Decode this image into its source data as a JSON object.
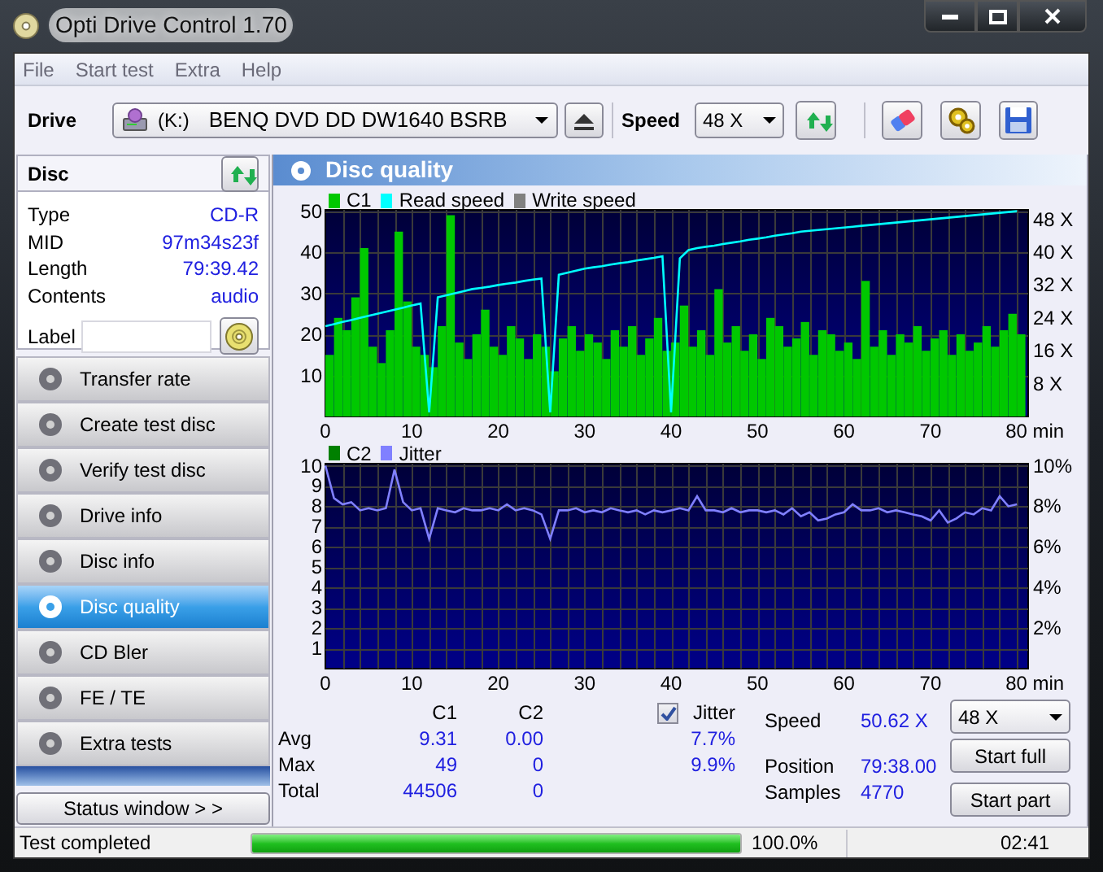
{
  "window": {
    "title": "Opti Drive Control 1.70"
  },
  "menu": [
    "File",
    "Start test",
    "Extra",
    "Help"
  ],
  "toolbar": {
    "drive_label": "Drive",
    "drive_letter": "(K:)",
    "drive_name": "BENQ DVD DD DW1640 BSRB",
    "speed_label": "Speed",
    "speed": "48 X"
  },
  "disc": {
    "title": "Disc",
    "fields": [
      {
        "label": "Type",
        "value": "CD-R"
      },
      {
        "label": "MID",
        "value": "97m34s23f"
      },
      {
        "label": "Length",
        "value": "79:39.42"
      },
      {
        "label": "Contents",
        "value": "audio"
      }
    ],
    "label_field": "Label"
  },
  "nav": [
    {
      "label": "Transfer rate",
      "selected": false
    },
    {
      "label": "Create test disc",
      "selected": false
    },
    {
      "label": "Verify test disc",
      "selected": false
    },
    {
      "label": "Drive info",
      "selected": false
    },
    {
      "label": "Disc info",
      "selected": false
    },
    {
      "label": "Disc quality",
      "selected": true
    },
    {
      "label": "CD Bler",
      "selected": false
    },
    {
      "label": "FE / TE",
      "selected": false
    },
    {
      "label": "Extra tests",
      "selected": false
    }
  ],
  "status_window_button": "Status window > >",
  "panel": {
    "title": "Disc quality",
    "charts": [
      {
        "chart_data": {
          "type": "bar",
          "x": [
            0,
            1,
            2,
            3,
            4,
            5,
            6,
            7,
            8,
            9,
            10,
            11,
            12,
            13,
            14,
            15,
            16,
            17,
            18,
            19,
            20,
            21,
            22,
            23,
            24,
            25,
            26,
            27,
            28,
            29,
            30,
            31,
            32,
            33,
            34,
            35,
            36,
            37,
            38,
            39,
            40,
            41,
            42,
            43,
            44,
            45,
            46,
            47,
            48,
            49,
            50,
            51,
            52,
            53,
            54,
            55,
            56,
            57,
            58,
            59,
            60,
            61,
            62,
            63,
            64,
            65,
            66,
            67,
            68,
            69,
            70,
            71,
            72,
            73,
            74,
            75,
            76,
            77,
            78,
            79,
            80
          ],
          "xlim": [
            0,
            81.3
          ],
          "ylim": [
            0,
            50.3
          ],
          "grid": true,
          "xticks": [
            0,
            10,
            20,
            30,
            40,
            50,
            60,
            70,
            {
              "value": 80,
              "label": "80 min"
            }
          ],
          "yticks": [
            10,
            20,
            30,
            40,
            50
          ],
          "y2lim": [
            0,
            50.3
          ],
          "y2ticks": [
            {
              "value": 8,
              "label": "8 X"
            },
            {
              "value": 16,
              "label": "16 X"
            },
            {
              "value": 24,
              "label": "24 X"
            },
            {
              "value": 32,
              "label": "32 X"
            },
            {
              "value": 40,
              "label": "40 X"
            },
            {
              "value": 48,
              "label": "48 X"
            }
          ],
          "series": [
            {
              "name": "C1",
              "color": "#00c800",
              "values": [
                15,
                24,
                21,
                29,
                41,
                17,
                13,
                21,
                45,
                28,
                17,
                15,
                12,
                22,
                49,
                18,
                14,
                20,
                26,
                17,
                15,
                22,
                19,
                14,
                20,
                17,
                11,
                19,
                22,
                16,
                20,
                18,
                14,
                21,
                17,
                22,
                15,
                19,
                24,
                16,
                18,
                27,
                17,
                21,
                15,
                31,
                18,
                22,
                16,
                20,
                14,
                24,
                22,
                17,
                19,
                23,
                15,
                21,
                20,
                16,
                18,
                14,
                33,
                17,
                21,
                15,
                20,
                18,
                22,
                16,
                19,
                21,
                15,
                20,
                16,
                18,
                22,
                17,
                21,
                25,
                20
              ]
            },
            {
              "name": "Read speed",
              "color": "#00ffff",
              "type": "line",
              "values": [
                22,
                22.5,
                23,
                23.5,
                24,
                24.5,
                25,
                25.5,
                26,
                26.5,
                27,
                27.5,
                1,
                29,
                29.5,
                30,
                30.5,
                31,
                31.3,
                31.6,
                32,
                32.3,
                32.6,
                33,
                33.3,
                33.6,
                1,
                34.5,
                35,
                35.5,
                36,
                36.3,
                36.6,
                37,
                37.3,
                37.6,
                38,
                38.3,
                38.6,
                39,
                1,
                38.5,
                40.5,
                41,
                41.3,
                41.6,
                42,
                42.3,
                42.6,
                43,
                43.3,
                43.6,
                44,
                44.3,
                44.6,
                45,
                45.2,
                45.4,
                45.6,
                45.8,
                46,
                46.2,
                46.4,
                46.6,
                46.8,
                47,
                47.2,
                47.4,
                47.6,
                47.8,
                48,
                48.2,
                48.4,
                48.6,
                48.8,
                49,
                49.2,
                49.4,
                49.6,
                49.8,
                50
              ]
            },
            {
              "name": "Write speed",
              "color": "#808080",
              "type": "line",
              "values": [
                null,
                null,
                null,
                null,
                null,
                null,
                null,
                null,
                null,
                null,
                null,
                null,
                null,
                null,
                null,
                null,
                null,
                null,
                null,
                null,
                null,
                null,
                null,
                null,
                null,
                null,
                null,
                null,
                null,
                null,
                null,
                null,
                null,
                null,
                null,
                null,
                null,
                null,
                null,
                null,
                null,
                null,
                null,
                null,
                null,
                null,
                null,
                null,
                null,
                null,
                null,
                null,
                null,
                null,
                null,
                null,
                null,
                null,
                null,
                null,
                null,
                null,
                null,
                null,
                null,
                null,
                null,
                null,
                null,
                null,
                null,
                null,
                null,
                null,
                null,
                null,
                null,
                null,
                null,
                null,
                null
              ]
            }
          ],
          "stacked": false
        }
      },
      {
        "chart_data": {
          "type": "line",
          "x": [
            0,
            1,
            2,
            3,
            4,
            5,
            6,
            7,
            8,
            9,
            10,
            11,
            12,
            13,
            14,
            15,
            16,
            17,
            18,
            19,
            20,
            21,
            22,
            23,
            24,
            25,
            26,
            27,
            28,
            29,
            30,
            31,
            32,
            33,
            34,
            35,
            36,
            37,
            38,
            39,
            40,
            41,
            42,
            43,
            44,
            45,
            46,
            47,
            48,
            49,
            50,
            51,
            52,
            53,
            54,
            55,
            56,
            57,
            58,
            59,
            60,
            61,
            62,
            63,
            64,
            65,
            66,
            67,
            68,
            69,
            70,
            71,
            72,
            73,
            74,
            75,
            76,
            77,
            78,
            79,
            80
          ],
          "xlim": [
            0,
            81.3
          ],
          "ylim": [
            0,
            10.1
          ],
          "grid": true,
          "xticks": [
            0,
            10,
            20,
            30,
            40,
            50,
            60,
            70,
            {
              "value": 80,
              "label": "80 min"
            }
          ],
          "yticks": [
            1,
            2,
            3,
            4,
            5,
            6,
            7,
            8,
            9,
            10
          ],
          "y2lim": [
            0,
            10.1
          ],
          "y2ticks": [
            {
              "value": 2,
              "label": "2%"
            },
            {
              "value": 4,
              "label": "4%"
            },
            {
              "value": 6,
              "label": "6%"
            },
            {
              "value": 8,
              "label": "8%"
            },
            {
              "value": 10,
              "label": "10%"
            }
          ],
          "series": [
            {
              "name": "C2",
              "color": "#008000",
              "type": "bar",
              "values": [
                0,
                0,
                0,
                0,
                0,
                0,
                0,
                0,
                0,
                0,
                0,
                0,
                0,
                0,
                0,
                0,
                0,
                0,
                0,
                0,
                0,
                0,
                0,
                0,
                0,
                0,
                0,
                0,
                0,
                0,
                0,
                0,
                0,
                0,
                0,
                0,
                0,
                0,
                0,
                0,
                0,
                0,
                0,
                0,
                0,
                0,
                0,
                0,
                0,
                0,
                0,
                0,
                0,
                0,
                0,
                0,
                0,
                0,
                0,
                0,
                0,
                0,
                0,
                0,
                0,
                0,
                0,
                0,
                0,
                0,
                0,
                0,
                0,
                0,
                0,
                0,
                0,
                0,
                0,
                0,
                0
              ]
            },
            {
              "name": "Jitter",
              "color": "#8080ff",
              "values": [
                10,
                8.4,
                8.1,
                8.2,
                7.8,
                7.9,
                7.8,
                7.9,
                9.8,
                8.2,
                7.8,
                7.9,
                6.4,
                7.9,
                7.8,
                7.7,
                7.9,
                7.8,
                7.8,
                7.9,
                7.8,
                8.1,
                7.8,
                7.9,
                7.8,
                7.6,
                6.4,
                7.8,
                7.8,
                7.9,
                7.7,
                7.8,
                7.7,
                7.9,
                7.8,
                7.7,
                7.8,
                7.6,
                7.8,
                7.7,
                7.8,
                7.9,
                7.8,
                8.5,
                7.8,
                7.8,
                7.7,
                7.9,
                7.7,
                7.8,
                7.8,
                7.7,
                7.8,
                7.6,
                7.9,
                7.5,
                7.7,
                7.3,
                7.4,
                7.6,
                7.7,
                8.1,
                7.8,
                7.8,
                7.9,
                7.7,
                7.8,
                7.7,
                7.6,
                7.5,
                7.3,
                7.8,
                7.2,
                7.4,
                7.7,
                7.6,
                7.9,
                7.8,
                8.5,
                8.0,
                8.1
              ]
            }
          ]
        }
      }
    ],
    "stats": {
      "columns": [
        "C1",
        "C2"
      ],
      "rows": [
        {
          "label": "Avg",
          "c1": "9.31",
          "c2": "0.00",
          "jitter": "7.7%"
        },
        {
          "label": "Max",
          "c1": "49",
          "c2": "0",
          "jitter": "9.9%"
        },
        {
          "label": "Total",
          "c1": "44506",
          "c2": "0"
        }
      ],
      "jitter": {
        "label": "Jitter",
        "checked": true
      }
    },
    "readout": [
      {
        "label": "Speed",
        "value": "50.62 X"
      },
      {
        "label": "Position",
        "value": "79:38.00"
      },
      {
        "label": "Samples",
        "value": "4770"
      }
    ],
    "speed_select": "48 X",
    "buttons": [
      "Start full",
      "Start part"
    ]
  },
  "status_bar": {
    "message": "Test completed",
    "progress": {
      "level": 1.0
    },
    "percent": "100.0%",
    "time": "02:41"
  }
}
